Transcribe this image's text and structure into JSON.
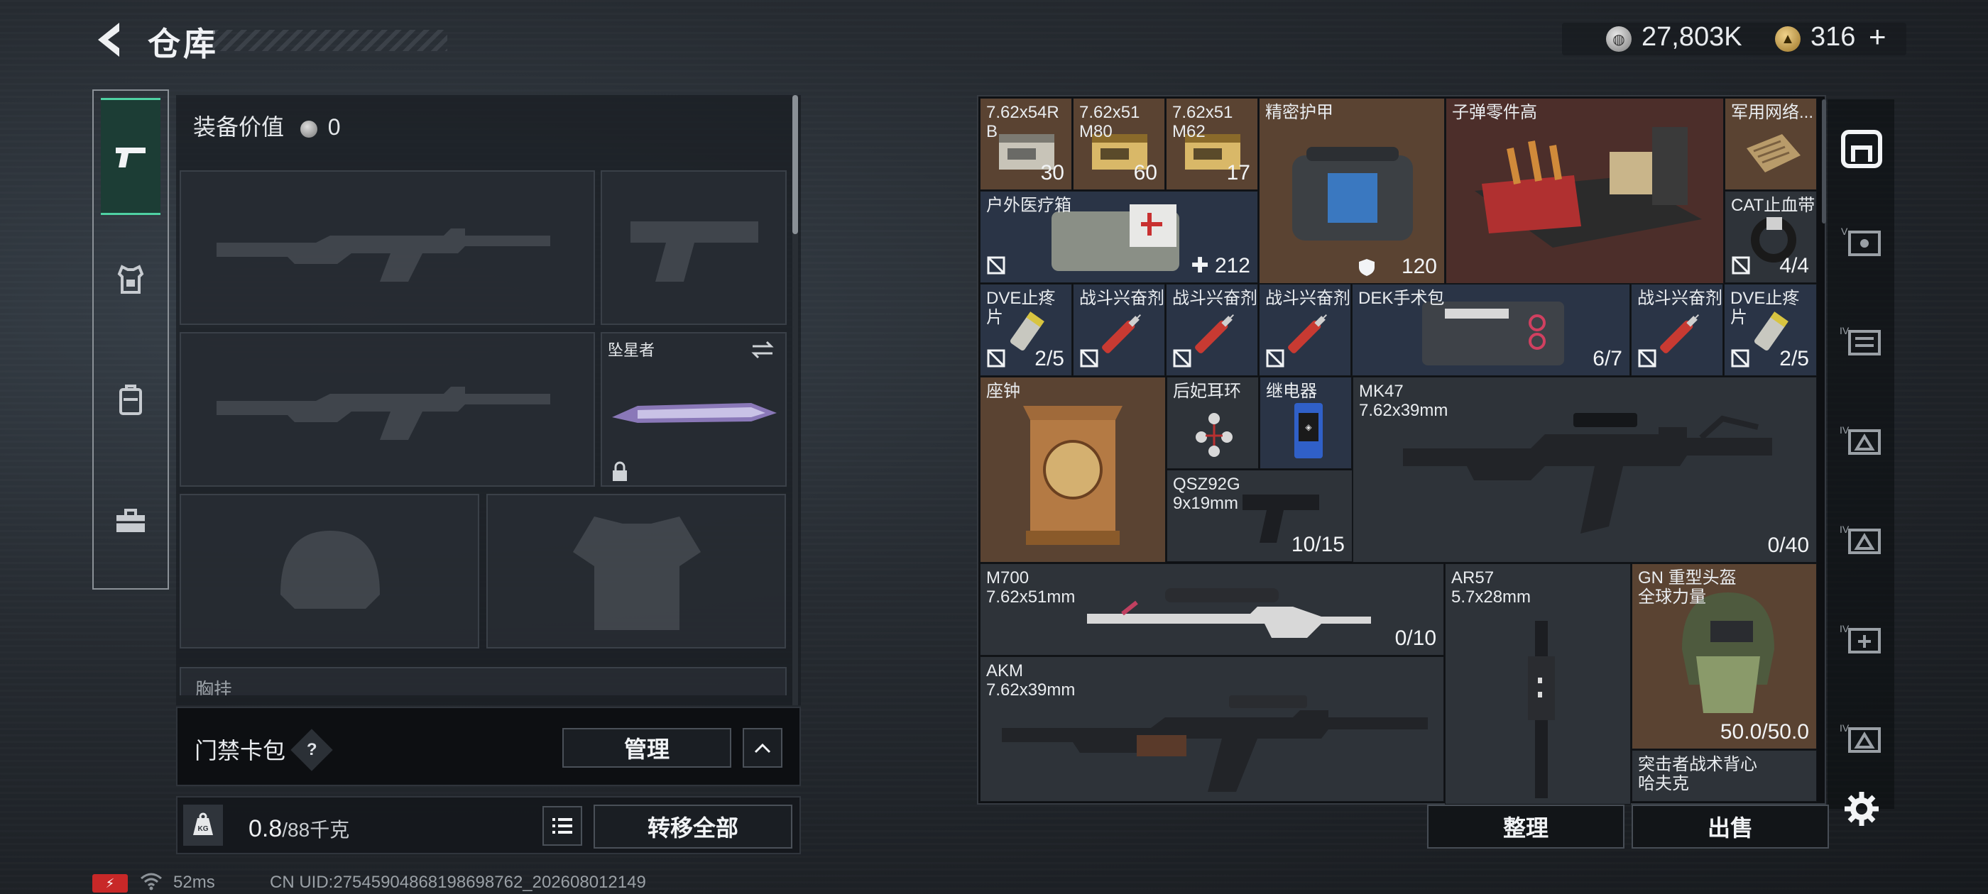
{
  "header": {
    "title": "仓库",
    "silver_amount": "27,803K",
    "gold_amount": "316",
    "gold_plus": "+"
  },
  "left_nav": {
    "items": [
      "pistol-icon",
      "armor-icon",
      "backpack-icon",
      "toolbox-icon"
    ],
    "active": 0
  },
  "equipment": {
    "value_label": "装备价值",
    "value": "0",
    "melee_slot_label": "坠星者",
    "next_section_label": "胸挂"
  },
  "access_card": {
    "label": "门禁卡包",
    "help": "?",
    "manage_button": "管理"
  },
  "weight": {
    "current": "0.8",
    "max": "/88千克",
    "transfer_all_button": "转移全部"
  },
  "status": {
    "ping": "52ms",
    "uid": "CN UID:27545904868198698762_202608012149"
  },
  "inventory": {
    "items": [
      {
        "name": "7.62x54R\nB",
        "count": "30"
      },
      {
        "name": "7.62x51\nM80",
        "count": "60"
      },
      {
        "name": "7.62x51\nM62",
        "count": "17"
      },
      {
        "name": "精密护甲",
        "count": "120"
      },
      {
        "name": "子弹零件高",
        "count": ""
      },
      {
        "name": "军用网络...",
        "count": ""
      },
      {
        "name": "户外医疗箱",
        "count": "212"
      },
      {
        "name": "CAT止血带",
        "count": "4/4"
      },
      {
        "name": "DVE止疼片",
        "count": "2/5"
      },
      {
        "name": "战斗兴奋剂",
        "count": ""
      },
      {
        "name": "战斗兴奋剂",
        "count": ""
      },
      {
        "name": "战斗兴奋剂",
        "count": ""
      },
      {
        "name": "DEK手术包",
        "count": "6/7"
      },
      {
        "name": "战斗兴奋剂",
        "count": ""
      },
      {
        "name": "DVE止疼片",
        "count": "2/5"
      },
      {
        "name": "座钟",
        "count": ""
      },
      {
        "name": "后妃耳环",
        "count": ""
      },
      {
        "name": "继电器",
        "count": ""
      },
      {
        "name": "MK47\n7.62x39mm",
        "count": "0/40"
      },
      {
        "name": "QSZ92G\n9x19mm",
        "count": "10/15"
      },
      {
        "name": "M700\n7.62x51mm",
        "count": "0/10"
      },
      {
        "name": "AR57\n5.7x28mm",
        "count": ""
      },
      {
        "name": "GN 重型头盔\n全球力量",
        "count": "50.0/50.0"
      },
      {
        "name": "AKM\n7.62x39mm",
        "count": ""
      },
      {
        "name": "突击者战术背心\n哈夫克",
        "count": ""
      }
    ]
  },
  "actions": {
    "organize_button": "整理",
    "sell_button": "出售"
  },
  "colors": {
    "accent_green": "#4fd1a3",
    "battery_red": "#c82828",
    "cell_brown": "#5a4332",
    "cell_blue": "#2a3446"
  }
}
